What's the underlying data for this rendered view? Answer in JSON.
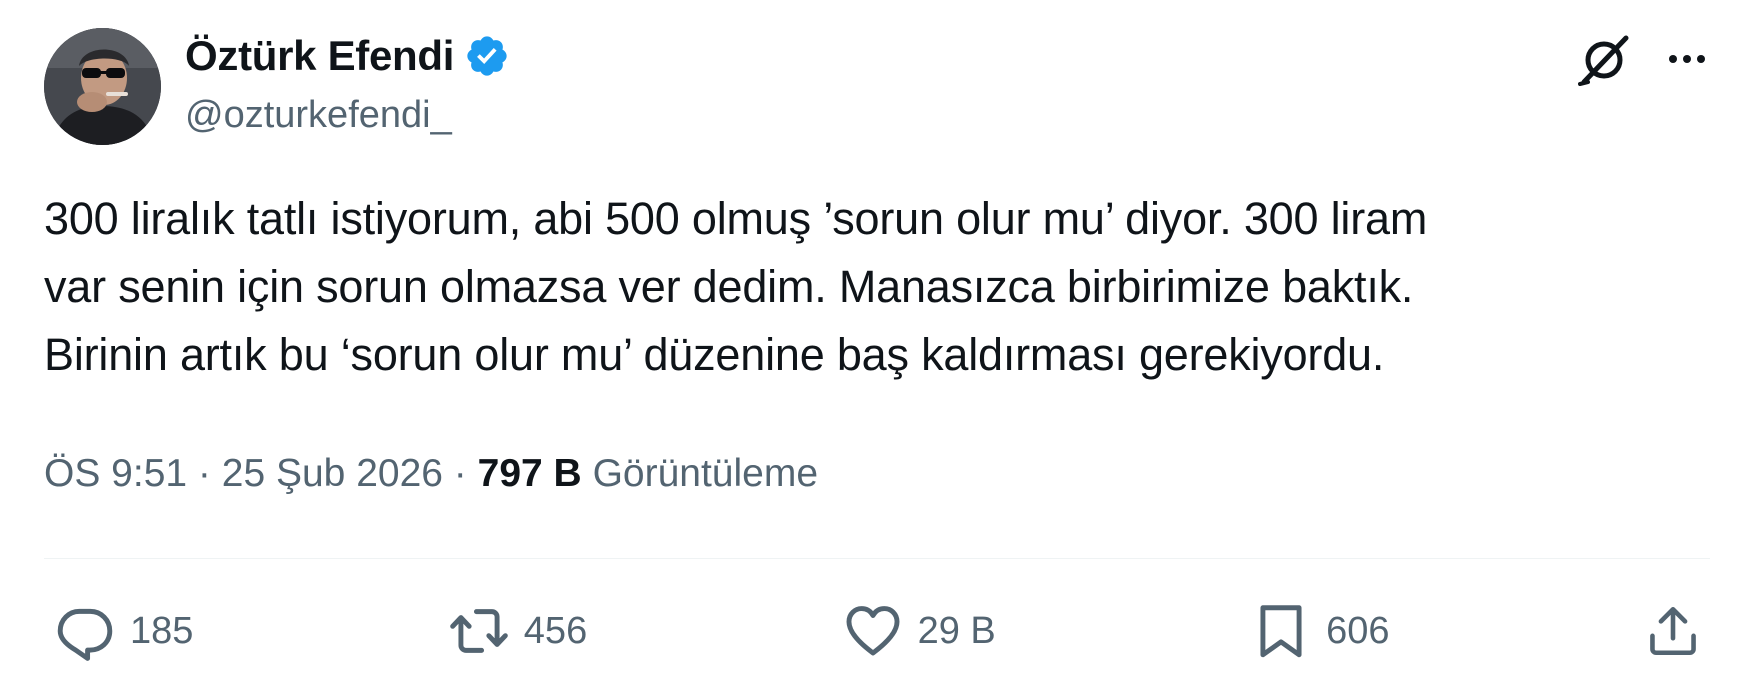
{
  "author": {
    "display_name": "Öztürk Efendi",
    "handle": "@ozturkefendi_",
    "verified": true,
    "avatar_icon": "person-with-sunglasses-avatar"
  },
  "header_actions": {
    "grok_icon": "grok-icon",
    "more_icon": "ellipsis-icon"
  },
  "tweet": {
    "lines": [
      "300 liralık tatlı istiyorum, abi 500 olmuş ’sorun olur mu’ diyor.  300 liram",
      "var senin için sorun olmazsa ver dedim. Manasızca birbirimize baktık.",
      "Birinin artık bu ‘sorun olur mu’ düzenine baş kaldırması gerekiyordu."
    ]
  },
  "meta": {
    "time": "ÖS 9:51",
    "separator": " · ",
    "date": "25 Şub 2026",
    "views_count": "797 B",
    "views_label": "Görüntüleme"
  },
  "actions": {
    "replies": "185",
    "reposts": "456",
    "likes": "29 B",
    "bookmarks": "606"
  },
  "colors": {
    "text": "#0f1419",
    "secondary": "#536471",
    "verified": "#1d9bf0",
    "divider": "#eff3f4"
  }
}
